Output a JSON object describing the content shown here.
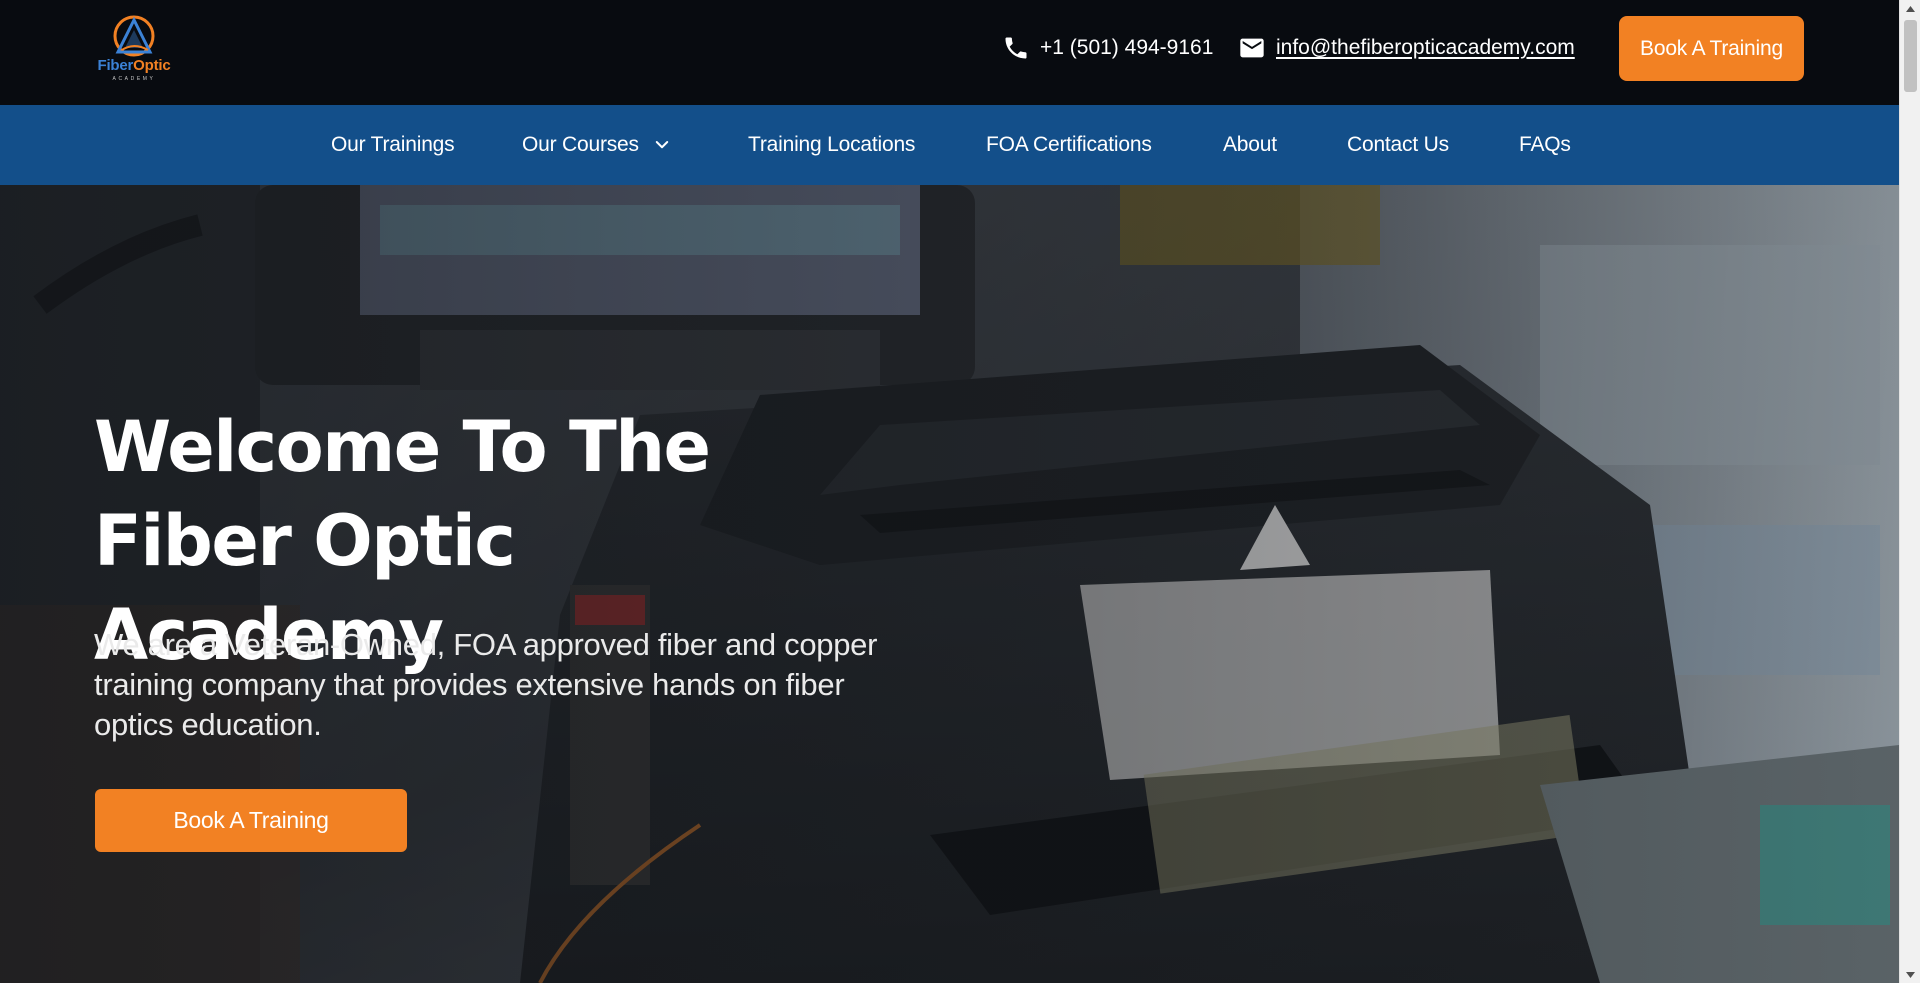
{
  "brand": {
    "logo_word1": "Fiber",
    "logo_word2": "Optic",
    "logo_sub": "ACADEMY",
    "colors": {
      "primary_blue": "#134f8a",
      "accent_orange": "#f28123",
      "topbar": "#080b10"
    }
  },
  "header": {
    "phone": {
      "icon": "phone-icon",
      "text": "+1 (501) 494-9161"
    },
    "email": {
      "icon": "mail-icon",
      "text": "info@thefiberopticacademy.com"
    },
    "cta_label": "Book A Training"
  },
  "nav": {
    "items": [
      {
        "label": "Our Trainings"
      },
      {
        "label": "Our Courses",
        "icon": "chevron-down-icon"
      },
      {
        "label": "Training Locations"
      },
      {
        "label": "FOA Certifications"
      },
      {
        "label": "About"
      },
      {
        "label": "Contact Us"
      },
      {
        "label": "FAQs"
      }
    ]
  },
  "hero": {
    "title": "Welcome To The Fiber Optic Academy",
    "subtitle": "We are a Veteran-Owned, FOA approved fiber and copper training company that provides extensive hands on fiber optics education.",
    "cta_label": "Book A Training",
    "image_icon": "fusion-splicer-photo"
  },
  "scrollbar": {
    "up_icon": "scroll-up-arrow-icon",
    "down_icon": "scroll-down-arrow-icon"
  }
}
